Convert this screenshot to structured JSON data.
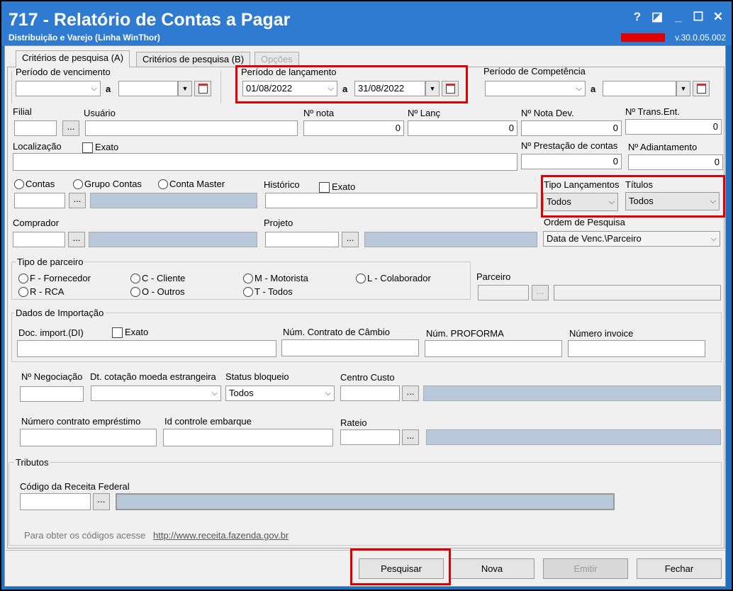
{
  "window": {
    "title": "717 - Relatório de Contas a Pagar",
    "subtitle": "Distribuição e Varejo (Linha WinThor)",
    "version": "v.30.0.05.002",
    "controls": {
      "help": "?",
      "restore": "◪",
      "minimize": "_",
      "maximize": "☐",
      "close": "✕"
    }
  },
  "tabs": [
    "Critérios de pesquisa (A)",
    "Critérios de pesquisa (B)",
    "Opções"
  ],
  "labels": {
    "periodo_vencimento": "Período de vencimento",
    "periodo_lancamento": "Período de lançamento",
    "periodo_competencia": "Período de Competência",
    "a": "a",
    "filial": "Filial",
    "usuario": "Usuário",
    "nota": "Nº nota",
    "lanc": "Nº Lanç",
    "nota_dev": "Nº Nota Dev.",
    "trans_ent": "Nº Trans.Ent.",
    "localizacao": "Localização",
    "exato": "Exato",
    "prestacao": "Nº Prestação de contas",
    "adiantamento": "Nº Adiantamento",
    "contas": "Contas",
    "grupo_contas": "Grupo Contas",
    "conta_master": "Conta Master",
    "historico": "Histórico",
    "tipo_lancamentos": "Tipo Lançamentos",
    "titulos": "Títulos",
    "comprador": "Comprador",
    "projeto": "Projeto",
    "ordem": "Ordem de Pesquisa",
    "tipo_parceiro": "Tipo de parceiro",
    "parceiro": "Parceiro",
    "dados_importacao": "Dados de Importação",
    "doc_import": "Doc. import.(DI)",
    "contrato_cambio": "Núm. Contrato de Câmbio",
    "proforma": "Núm. PROFORMA",
    "invoice": "Número invoice",
    "negociacao": "Nº Negociação",
    "cotacao": "Dt. cotação moeda estrangeira",
    "status_bloqueio": "Status bloqueio",
    "centro_custo": "Centro Custo",
    "contrato_emprestimo": "Número contrato empréstimo",
    "controle_embarque": "Id controle embarque",
    "rateio": "Rateio",
    "tributos": "Tributos",
    "codigo_receita": "Código da Receita Federal",
    "obter_codigos": "Para obter os códigos acesse",
    "receita_link": "http://www.receita.fazenda.gov.br"
  },
  "values": {
    "lanc_inicio": "01/08/2022",
    "lanc_fim": "31/08/2022",
    "nota": "0",
    "lanc": "0",
    "nota_dev": "0",
    "trans_ent": "0",
    "prestacao": "0",
    "adiantamento": "0",
    "tipo_lancamentos": "Todos",
    "titulos": "Todos",
    "ordem": "Data de Venc.\\Parceiro",
    "status_bloqueio": "Todos",
    "dots": "..."
  },
  "parceiro_radios": [
    "F - Fornecedor",
    "R - RCA",
    "C - Cliente",
    "O - Outros",
    "M - Motorista",
    "T - Todos",
    "L - Colaborador"
  ],
  "buttons": {
    "pesquisar": "Pesquisar",
    "nova": "Nova",
    "emitir": "Emitir",
    "fechar": "Fechar"
  },
  "highlight_color": "#e00000"
}
